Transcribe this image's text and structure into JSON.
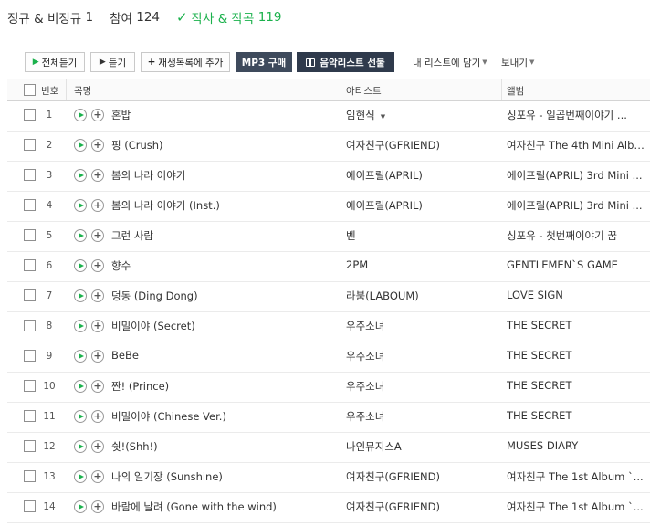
{
  "summary": {
    "category": "정규 & 비정규",
    "category_count": "1",
    "participation": "참여",
    "participation_count": "124",
    "writer_label": "작사 & 작곡",
    "writer_count": "119"
  },
  "toolbar": {
    "play_all": "전체듣기",
    "play": "듣기",
    "add_playlist": "재생목록에 추가",
    "mp3_buy": "MP3 구매",
    "gift_list": "음악리스트 선물",
    "add_my_list": "내 리스트에 담기",
    "send": "보내기"
  },
  "table": {
    "headers": {
      "number": "번호",
      "song": "곡명",
      "artist": "아티스트",
      "album": "앨범"
    },
    "rows": [
      {
        "no": "1",
        "title": "혼밥",
        "artist": "임현식",
        "artist_dropdown": true,
        "album": "싱포유 - 일곱번째이야기 ..."
      },
      {
        "no": "2",
        "title": "핑 (Crush)",
        "artist": "여자친구(GFRIEND)",
        "album": "여자친구 The 4th Mini Album ..."
      },
      {
        "no": "3",
        "title": "봄의 나라 이야기",
        "artist": "에이프릴(APRIL)",
        "album": "에이프릴(APRIL) 3rd Mini ..."
      },
      {
        "no": "4",
        "title": "봄의 나라 이야기 (Inst.)",
        "artist": "에이프릴(APRIL)",
        "album": "에이프릴(APRIL) 3rd Mini ..."
      },
      {
        "no": "5",
        "title": "그런 사람",
        "artist": "벤",
        "album": "싱포유 - 첫번째이야기 꿈"
      },
      {
        "no": "6",
        "title": "향수",
        "artist": "2PM",
        "album": "GENTLEMEN`S GAME"
      },
      {
        "no": "7",
        "title": "덩동 (Ding Dong)",
        "artist": "라붐(LABOUM)",
        "album": "LOVE SIGN"
      },
      {
        "no": "8",
        "title": "비밀이야 (Secret)",
        "artist": "우주소녀",
        "album": "THE SECRET"
      },
      {
        "no": "9",
        "title": "BeBe",
        "artist": "우주소녀",
        "album": "THE SECRET"
      },
      {
        "no": "10",
        "title": "짠! (Prince)",
        "artist": "우주소녀",
        "album": "THE SECRET"
      },
      {
        "no": "11",
        "title": "비밀이야 (Chinese Ver.)",
        "artist": "우주소녀",
        "album": "THE SECRET"
      },
      {
        "no": "12",
        "title": "쉿!(Shh!)",
        "artist": "나인뮤지스A",
        "album": "MUSES DIARY"
      },
      {
        "no": "13",
        "title": "나의 일기장 (Sunshine)",
        "artist": "여자친구(GFRIEND)",
        "album": "여자친구 The 1st Album `..."
      },
      {
        "no": "14",
        "title": "바람에 날려 (Gone with the wind)",
        "artist": "여자친구(GFRIEND)",
        "album": "여자친구 The 1st Album `..."
      }
    ]
  }
}
